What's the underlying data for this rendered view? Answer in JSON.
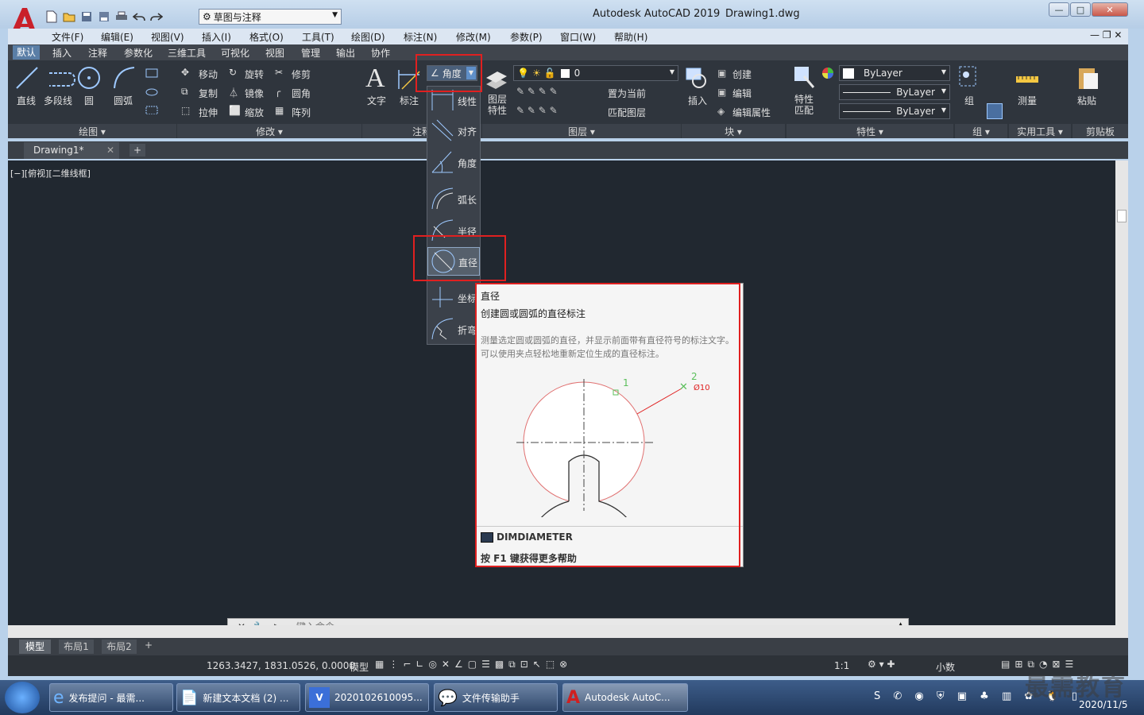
{
  "window": {
    "app_title": "Autodesk AutoCAD 2019",
    "file_title": "Drawing1.dwg",
    "workspace": "草图与注释",
    "controls": [
      "—",
      "□",
      "✕"
    ]
  },
  "menu": [
    "文件(F)",
    "编辑(E)",
    "视图(V)",
    "插入(I)",
    "格式(O)",
    "工具(T)",
    "绘图(D)",
    "标注(N)",
    "修改(M)",
    "参数(P)",
    "窗口(W)",
    "帮助(H)"
  ],
  "ribbon_tabs": [
    "默认",
    "插入",
    "注释",
    "参数化",
    "三维工具",
    "可视化",
    "视图",
    "管理",
    "输出",
    "协作"
  ],
  "ribbon": {
    "draw": {
      "items": [
        "直线",
        "多段线",
        "圆",
        "圆弧"
      ],
      "panel": "绘图 ▾"
    },
    "modify": {
      "items": [
        "移动",
        "旋转",
        "修剪",
        "复制",
        "镜像",
        "圆角",
        "拉伸",
        "缩放",
        "阵列"
      ],
      "panel": "修改 ▾"
    },
    "annotation": {
      "text": "文字",
      "dim": "标注",
      "combo": "角度",
      "linear": "线性",
      "panel": "注释"
    },
    "layer": {
      "props": "图层\n特性",
      "combo_value": "0",
      "set_current": "置为当前",
      "match": "匹配图层",
      "panel": "图层 ▾"
    },
    "block": {
      "insert": "插入",
      "create": "创建",
      "edit": "编辑",
      "edit_attr": "编辑属性",
      "panel": "块 ▾"
    },
    "properties": {
      "match": "特性\n匹配",
      "color": "ByLayer",
      "linetype": "ByLayer",
      "lineweight": "ByLayer",
      "panel": "特性 ▾"
    },
    "group": {
      "label": "组",
      "panel": "组 ▾"
    },
    "utilities": {
      "measure": "测量",
      "panel": "实用工具 ▾"
    },
    "clipboard": {
      "paste": "粘贴",
      "panel": "剪贴板"
    }
  },
  "doc_tab": "Drawing1*",
  "viewport_label": "[−][俯视][二维线框]",
  "dim_dropdown": [
    "线性",
    "对齐",
    "角度",
    "弧长",
    "半径",
    "直径",
    "坐标",
    "折弯"
  ],
  "tooltip": {
    "title": "直径",
    "desc": "创建圆或圆弧的直径标注",
    "detail": "测量选定圆或圆弧的直径，并显示前面带有直径符号的标注文字。可以使用夹点轻松地重新定位生成的直径标注。",
    "label1": "1",
    "label2": "2",
    "dimtext": "Ø10",
    "command": "DIMDIAMETER",
    "help": "按 F1 键获得更多帮助"
  },
  "cmdline_placeholder": "键入命令",
  "layout_tabs": [
    "模型",
    "布局1",
    "布局2"
  ],
  "status": {
    "coords": "1263.3427, 1831.0526, 0.0000",
    "model": "模型",
    "scale": "1:1",
    "units": "小数"
  },
  "taskbar": {
    "tasks": [
      "发布提问 - 最需...",
      "新建文本文档 (2) ...",
      "2020102610095...",
      "文件传输助手",
      "Autodesk AutoC..."
    ],
    "date": "2020/11/5",
    "watermark": "最需教育"
  },
  "colors": {
    "accent": "#e02020",
    "ribbon": "#2f353d",
    "drawing": "#212830"
  }
}
